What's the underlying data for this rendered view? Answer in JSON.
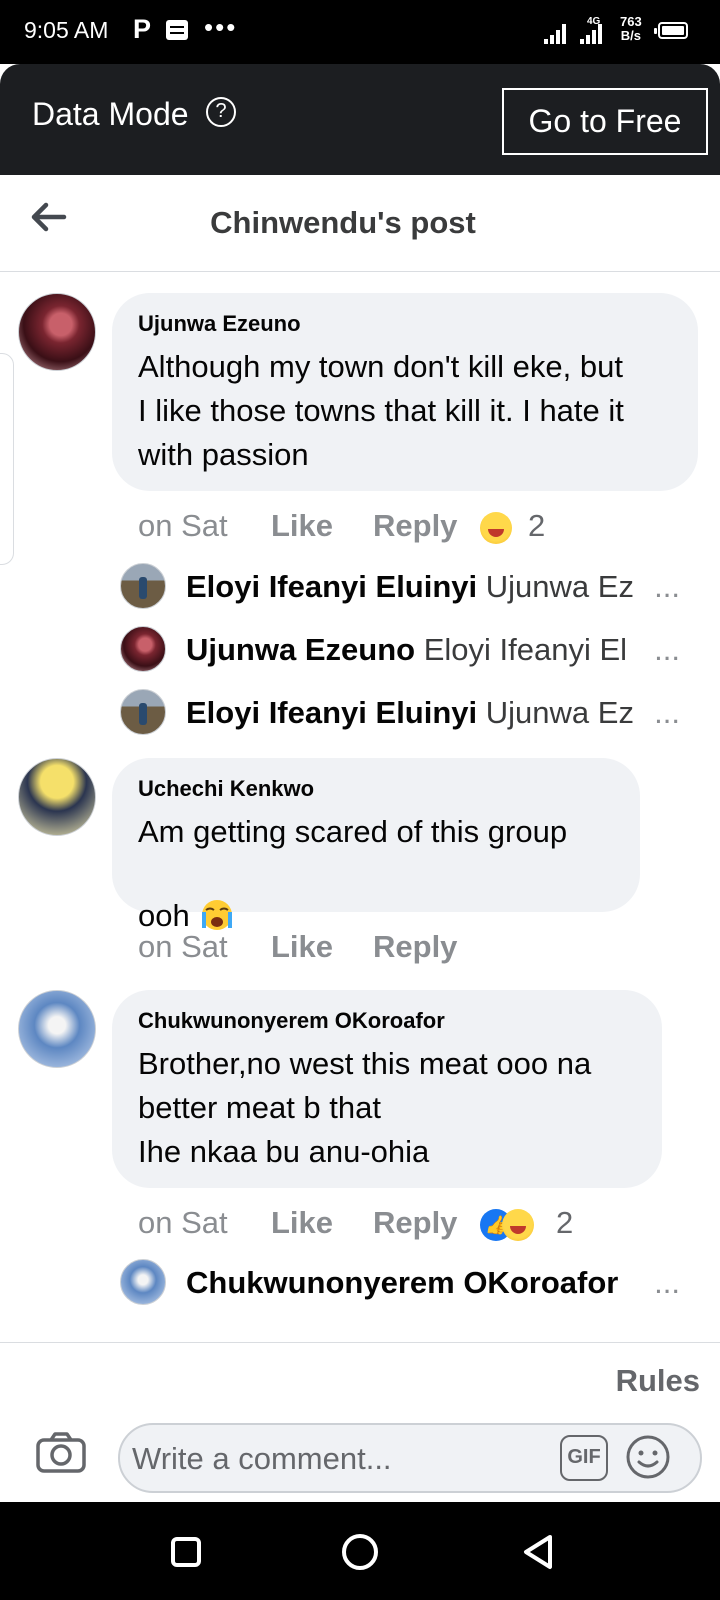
{
  "status_bar": {
    "time": "9:05 AM",
    "p_icon": "P",
    "dots": "•••",
    "network": "4G",
    "speed_value": "763",
    "speed_unit": "B/s"
  },
  "data_mode": {
    "label": "Data Mode",
    "help": "?",
    "go_free_label": "Go to Free"
  },
  "header": {
    "title": "Chinwendu's post"
  },
  "comments": [
    {
      "author": "Ujunwa Ezeuno",
      "text": "Although my town don't kill eke, but\nI like those towns that kill it. I hate it\nwith passion",
      "time": "on Sat",
      "like": "Like",
      "reply": "Reply",
      "reaction_count": "2",
      "replies": [
        {
          "name": "Eloyi Ifeanyi Eluinyi",
          "preview": "Ujunwa Ez"
        },
        {
          "name": "Ujunwa Ezeuno",
          "preview": "Eloyi Ifeanyi El"
        },
        {
          "name": "Eloyi Ifeanyi Eluinyi",
          "preview": "Ujunwa Ez"
        }
      ]
    },
    {
      "author": "Uchechi Kenkwo",
      "text": "Am getting scared of this group\nooh",
      "time": "on Sat",
      "like": "Like",
      "reply": "Reply"
    },
    {
      "author": "Chukwunonyerem OKoroafor",
      "text": "Brother,no west this meat ooo na\nbetter meat b that\nIhe nkaa bu anu-ohia",
      "time": "on Sat",
      "like": "Like",
      "reply": "Reply",
      "reaction_count": "2",
      "replies": [
        {
          "name": "Chukwunonyerem OKoroafor",
          "preview": ""
        }
      ]
    }
  ],
  "ellipsis": "...",
  "composer": {
    "rules_label": "Rules",
    "placeholder": "Write a comment...",
    "gif_label": "GIF"
  },
  "icons": {
    "back": "arrow-left-icon",
    "camera": "camera-icon",
    "gif": "gif-icon",
    "emoji": "smiley-icon",
    "help": "question-circle-icon"
  },
  "colors": {
    "bubble": "#f0f2f5",
    "meta": "#8a8d91",
    "like_blue": "#1877f2",
    "data_bar": "#1c1e21"
  }
}
